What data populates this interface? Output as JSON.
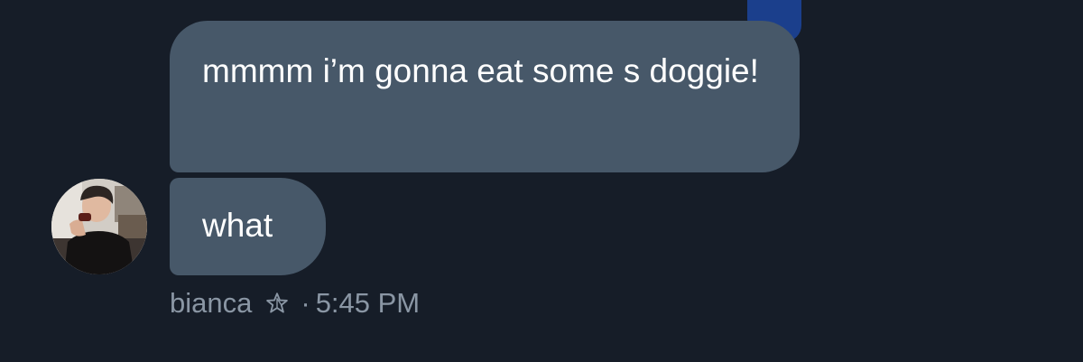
{
  "messages": [
    {
      "text": "mmmm i’m gonna eat some s doggie!"
    },
    {
      "text": "what"
    }
  ],
  "sender": {
    "name": "bianca",
    "badge_icon": "star-outline-icon",
    "separator": "·",
    "timestamp": "5:45 PM"
  },
  "colors": {
    "background": "#161d28",
    "bubble": "#475869",
    "bubble_text": "#ffffff",
    "meta_text": "#8a96a4",
    "accent": "#1b3f8c"
  }
}
